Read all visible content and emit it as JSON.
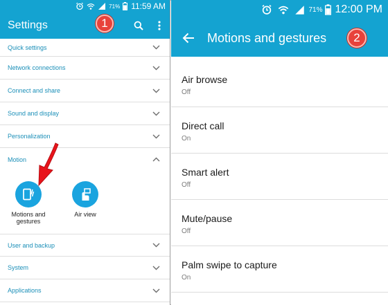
{
  "left": {
    "status": {
      "battery_pct": "71%",
      "time": "11:59 AM"
    },
    "title": "Settings",
    "badge": "1",
    "rows": [
      {
        "label": "Quick settings"
      },
      {
        "label": "Network connections"
      },
      {
        "label": "Connect and share"
      },
      {
        "label": "Sound and display"
      },
      {
        "label": "Personalization"
      },
      {
        "label": "Motion"
      },
      {
        "label": "User and backup"
      },
      {
        "label": "System"
      },
      {
        "label": "Applications"
      }
    ],
    "motion_items": [
      {
        "label_line1": "Motions and",
        "label_line2": "gestures"
      },
      {
        "label_line1": "Air view",
        "label_line2": ""
      }
    ]
  },
  "right": {
    "status": {
      "battery_pct": "71%",
      "time": "12:00 PM"
    },
    "title": "Motions and gestures",
    "badge": "2",
    "rows": [
      {
        "name": "Air browse",
        "state": "Off"
      },
      {
        "name": "Direct call",
        "state": "On"
      },
      {
        "name": "Smart alert",
        "state": "Off"
      },
      {
        "name": "Mute/pause",
        "state": "Off"
      },
      {
        "name": "Palm swipe to capture",
        "state": "On"
      }
    ]
  },
  "colors": {
    "accent": "#14a3d1",
    "section_label": "#1b8fb8",
    "badge": "#e8423b",
    "arrow": "#e8141b"
  }
}
